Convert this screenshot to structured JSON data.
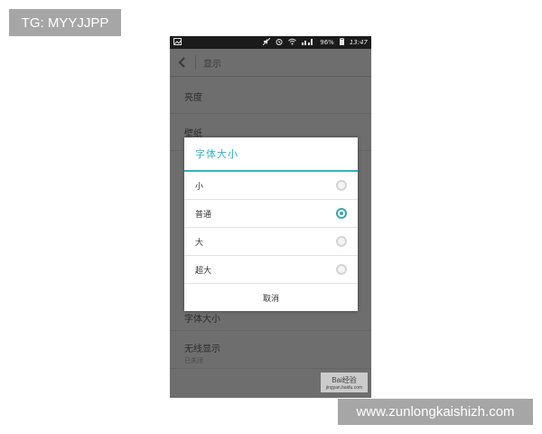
{
  "overlay": {
    "top_left_badge": "TG: MYYJJPP",
    "bottom_right_badge": "www.zunlongkaishizh.com"
  },
  "statusbar": {
    "time": "13:47",
    "battery": "96%"
  },
  "actionbar": {
    "title": "显示"
  },
  "settings": {
    "brightness": "亮度",
    "wallpaper": "壁纸",
    "font_size": "字体大小",
    "wireless_display": "无线显示",
    "wireless_display_status": "已关闭"
  },
  "dialog": {
    "title": "字体大小",
    "options": [
      {
        "label": "小",
        "selected": false
      },
      {
        "label": "普通",
        "selected": true
      },
      {
        "label": "大",
        "selected": false
      },
      {
        "label": "超大",
        "selected": false
      }
    ],
    "cancel_label": "取消",
    "accent_color": "#2eb3c6"
  },
  "watermark": {
    "brand": "Bai经验",
    "url": "jingyan.baidu.com"
  }
}
